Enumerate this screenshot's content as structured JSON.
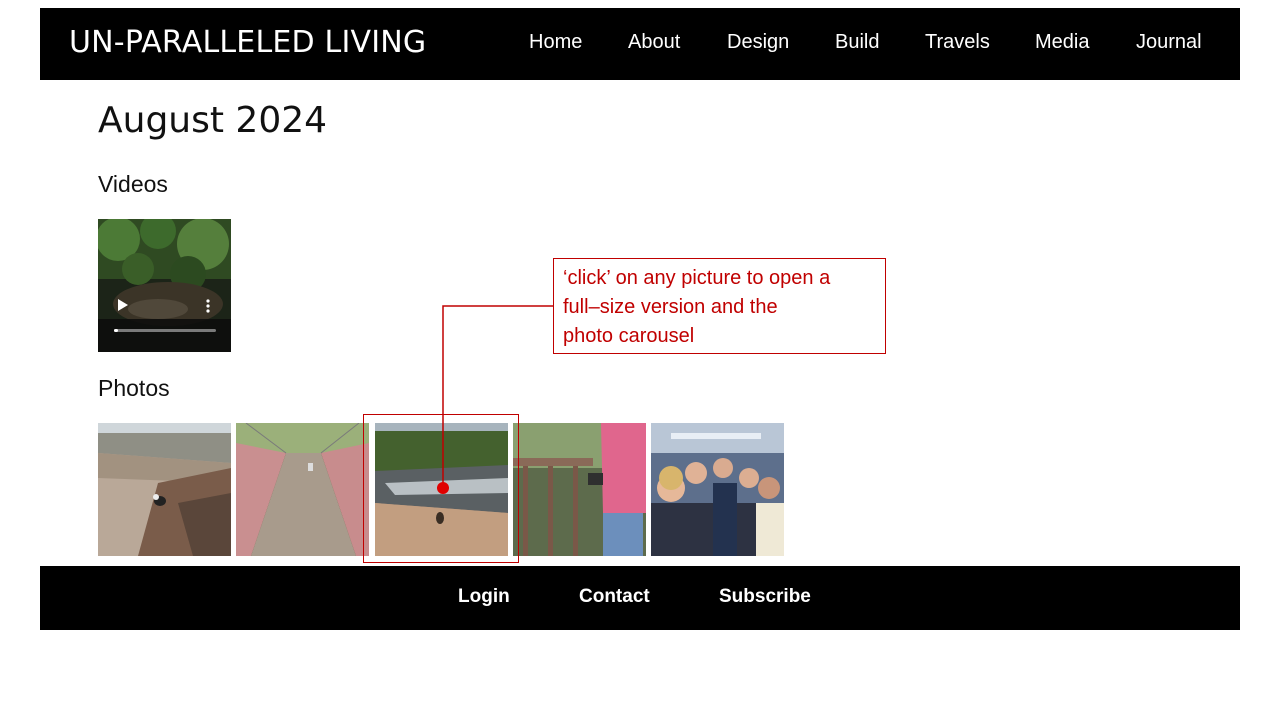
{
  "header": {
    "site_title": "UN-PARALLELED LIVING",
    "nav": [
      "Home",
      "About",
      "Design",
      "Build",
      "Travels",
      "Media",
      "Journal"
    ]
  },
  "main": {
    "page_title": "August 2024",
    "videos_heading": "Videos",
    "photos_heading": "Photos"
  },
  "annotation": {
    "callout_lines": [
      "‘click’ on any picture to open a",
      "full–size version and the",
      "photo carousel"
    ],
    "color": "#c00000"
  },
  "footer": {
    "links": [
      "Login",
      "Contact",
      "Subscribe"
    ]
  }
}
